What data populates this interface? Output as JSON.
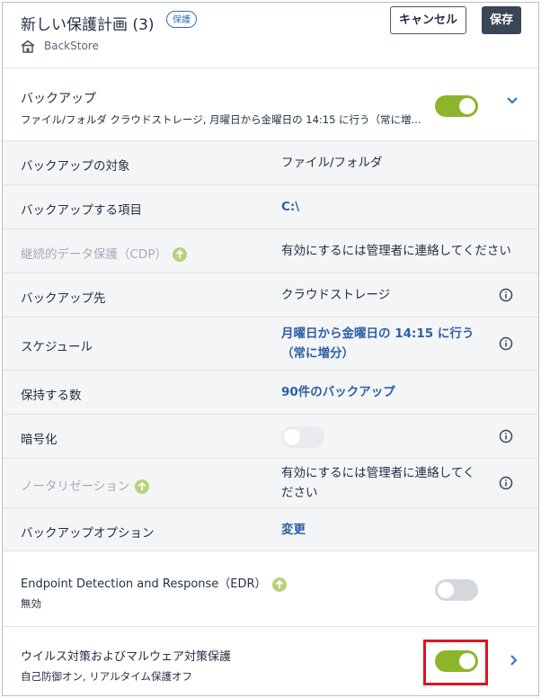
{
  "header": {
    "title": "新しい保護計画 (3)",
    "badge": "保護",
    "cancel_label": "キャンセル",
    "save_label": "保存",
    "machine_name": "BackStore"
  },
  "backup": {
    "title": "バックアップ",
    "summary": "ファイル/フォルダ クラウドストレージ, 月曜日から金曜日の 14:15 に行う（常に増...",
    "enabled": true
  },
  "rows": [
    {
      "label": "バックアップの対象",
      "value": "ファイル/フォルダ"
    },
    {
      "label": "バックアップする項目",
      "value": "C:\\"
    },
    {
      "label": "継続的データ保護（CDP）",
      "value": "有効にするには管理者に連絡してください"
    },
    {
      "label": "バックアップ先",
      "value": "クラウドストレージ"
    },
    {
      "label": "スケジュール",
      "value_line1": "月曜日から金曜日の 14:15 に行う",
      "value_line2": "（常に増分）"
    },
    {
      "label": "保持する数",
      "value": "90件のバックアップ"
    },
    {
      "label": "暗号化",
      "enabled": false
    },
    {
      "label": "ノータリゼーション",
      "value_line1": "有効にするには管理者に連絡してく",
      "value_line2": "ださい"
    },
    {
      "label": "バックアップオプション",
      "value": "変更"
    }
  ],
  "edr": {
    "title": "Endpoint Detection and Response（EDR）",
    "status": "無効",
    "enabled": false
  },
  "antivirus": {
    "title": "ウイルス対策およびマルウェア対策保護",
    "status": "自己防御オン, リアルタイム保護オフ",
    "enabled": true
  },
  "colors": {
    "toggle_on": "#8cb52c",
    "link": "#2d5fa8",
    "highlight": "#e0141e",
    "accent_blue": "#2d6ec4"
  }
}
